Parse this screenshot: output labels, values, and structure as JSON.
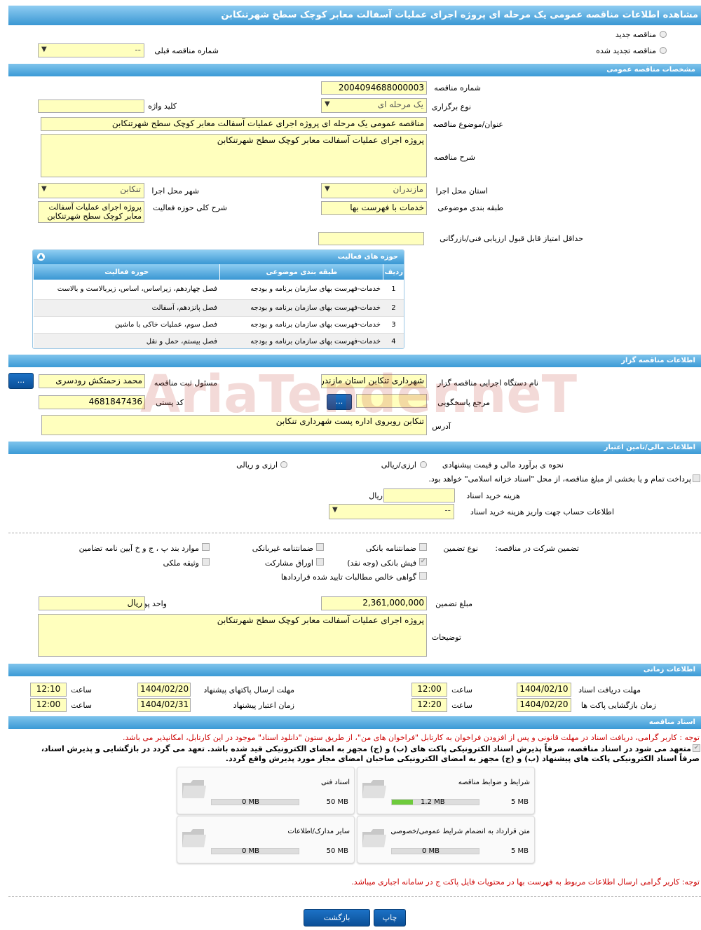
{
  "title": "مشاهده اطلاعات مناقصه عمومی یک مرحله ای پروژه اجرای عملیات آسفالت معابر کوچک سطح شهرتنکابن",
  "top": {
    "new_tender": "مناقصه جدید",
    "renewed_tender": "مناقصه تجدید شده",
    "prev_number_label": "شماره مناقصه قبلی",
    "prev_number_value": "--"
  },
  "general": {
    "header": "مشخصات مناقصه عمومی",
    "number_label": "شماره مناقصه",
    "number_value": "2004094688000003",
    "type_label": "نوع برگزاری",
    "type_value": "یک مرحله ای",
    "keyword_label": "کلید واژه",
    "keyword_value": "",
    "subject_label": "عنوان/موضوع مناقصه",
    "subject_value": "مناقصه عمومی یک مرحله ای پروژه اجرای عملیات آسفالت معابر کوچک سطح شهرتنکابن",
    "desc_label": "شرح مناقصه",
    "desc_value": "پروژه اجرای عملیات آسفالت معابر کوچک سطح شهرتنکابن",
    "province_label": "استان محل اجرا",
    "province_value": "مازندران",
    "city_label": "شهر محل اجرا",
    "city_value": "تنکابن",
    "category_label": "طبقه بندی موضوعی",
    "category_value": "خدمات با فهرست بها",
    "scope_label": "شرح کلی حوزه فعالیت",
    "scope_value": "پروژه اجرای عملیات آسفالت معابر کوچک سطح شهرتنکابن",
    "min_score_label": "حداقل امتیاز قابل قبول ارزیابی فنی/بازرگانی",
    "min_score_value": ""
  },
  "activities": {
    "header": "حوزه های فعالیت",
    "columns": [
      "ردیف",
      "طبقه بندی موضوعی",
      "حوزه فعالیت"
    ],
    "rows": [
      {
        "n": "1",
        "cat": "خدمات-فهرست بهای سازمان برنامه و بودجه",
        "area": "فصل چهاردهم، زیراساس، اساس، زیربالاست و بالاست"
      },
      {
        "n": "2",
        "cat": "خدمات-فهرست بهای سازمان برنامه و بودجه",
        "area": "فصل پانزدهم، آسفالت"
      },
      {
        "n": "3",
        "cat": "خدمات-فهرست بهای سازمان برنامه و بودجه",
        "area": "فصل سوم، عملیات خاکی با ماشین"
      },
      {
        "n": "4",
        "cat": "خدمات-فهرست بهای سازمان برنامه و بودجه",
        "area": "فصل بیستم، حمل و نقل"
      }
    ]
  },
  "organizer": {
    "header": "اطلاعات مناقصه گزار",
    "org_label": "نام دستگاه اجرایی مناقصه گزار",
    "org_value": "شهرداری تنکابن استان مازندران",
    "resp_label": "مسئول ثبت مناقصه",
    "resp_value": "محمد زحمتکش رودسری",
    "ref_label": "مرجع پاسخگویی",
    "ref_value": "",
    "postal_label": "کد پستی",
    "postal_value": "4681847436",
    "address_label": "آدرس",
    "address_value": "تنکابن روبروی اداره پست شهرداری تنکابن",
    "dots": "..."
  },
  "finance": {
    "header": "اطلاعات مالی/تامین اعتبار",
    "estimate_label": "نحوه ی برآورد مالی و قیمت پیشنهادی",
    "opt1": "ارزی/ریالی",
    "opt2": "ارزی و ریالی",
    "treasury_text": "پرداخت تمام و یا بخشی از مبلغ مناقصه، از محل \"اسناد خزانه اسلامی\" خواهد بود.",
    "doc_cost_label": "هزینه خرید اسناد",
    "doc_cost_unit": "ریال",
    "doc_cost_value": "",
    "account_label": "اطلاعات حساب جهت واریز هزینه خرید اسناد",
    "account_value": "--"
  },
  "guarantee": {
    "label": "تضمین شرکت در مناقصه:",
    "type_label": "نوع تضمین",
    "bank": "ضمانتنامه بانکی",
    "nonbank": "ضمانتنامه غیربانکی",
    "items_bcd": "موارد بند پ ، ج و خ آیین نامه تضامین",
    "fish": "فیش بانکی (وجه نقد)",
    "bonds": "اوراق مشارکت",
    "property": "وثیقه ملکی",
    "certificate": "گواهی خالص مطالبات تایید شده قراردادها",
    "amount_label": "مبلغ تضمین",
    "amount_value": "2,361,000,000",
    "currency_label": "واحد پول",
    "currency_value": "ریال",
    "notes_label": "توضیحات",
    "notes_value": "پروژه اجرای عملیات آسفالت معابر کوچک سطح شهرتنکابن"
  },
  "timing": {
    "header": "اطلاعات زمانی",
    "receive_label": "مهلت دریافت اسناد",
    "receive_date": "1404/02/10",
    "receive_time": "12:00",
    "send_label": "مهلت ارسال پاکتهای پیشنهاد",
    "send_date": "1404/02/20",
    "send_time": "12:10",
    "open_label": "زمان بازگشایی پاکت ها",
    "open_date": "1404/02/20",
    "open_time": "12:20",
    "valid_label": "زمان اعتبار پیشنهاد",
    "valid_date": "1404/02/31",
    "valid_time": "12:00",
    "time_label": "ساعت"
  },
  "docs": {
    "header": "اسناد مناقصه",
    "note1": "توجه : کاربر گرامی، دریافت اسناد در مهلت قانونی و پس از افزودن فراخوان به کارتابل \"فراخوان های من\"، از طریق ستون \"دانلود اسناد\" موجود در این کارتابل، امکانپذیر می باشد.",
    "commit1": "متعهد می شود در اسناد مناقصه، صرفاً پذیرش اسناد الکترونیکی پاکت های (ب) و (ج) مجهز به امضای الکترونیکی قید شده باشد. تعهد می گردد در بازگشایی و پذیرش اسناد،",
    "commit2": "صرفاً اسناد الکترونیکی پاکت های پیشنهاد (ب) و (ج) مجهز به امضای الکترونیکی صاحبان امضای مجاز مورد پذیرش واقع گردد.",
    "files": [
      {
        "name": "شرایط و ضوابط مناقصه",
        "used": "1.2 MB",
        "max": "5 MB",
        "pct": 0.24
      },
      {
        "name": "اسناد فنی",
        "used": "0 MB",
        "max": "50 MB",
        "pct": 0
      },
      {
        "name": "متن قرارداد به انضمام شرایط عمومی/خصوصی",
        "used": "0 MB",
        "max": "5 MB",
        "pct": 0
      },
      {
        "name": "سایر مدارک/اطلاعات",
        "used": "0 MB",
        "max": "50 MB",
        "pct": 0
      }
    ],
    "note2": "توجه: کاربر گرامی ارسال اطلاعات مربوط به فهرست بها در محتویات فایل پاکت ج در سامانه اجباری میباشد."
  },
  "buttons": {
    "print": "چاپ",
    "back": "بازگشت"
  },
  "watermark": "AriaTender.neT"
}
